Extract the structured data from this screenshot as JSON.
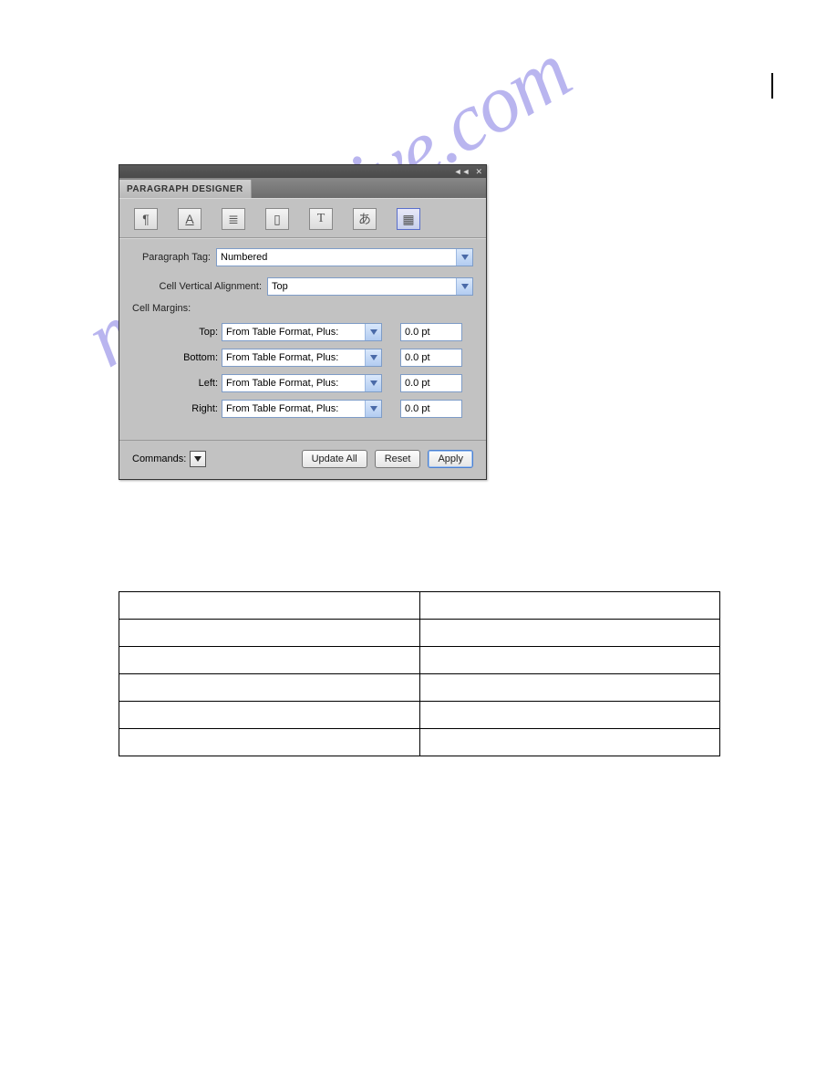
{
  "watermark": "manualshive.com",
  "titlebar": {
    "collapse": "◄◄",
    "close": "✕"
  },
  "tab": {
    "label": "PARAGRAPH DESIGNER"
  },
  "icons": {
    "pilcrow": "¶",
    "font": "A",
    "pagination": "≣",
    "numbering": "▯",
    "advanced": "T",
    "asian": "あ",
    "tablecell": "▦"
  },
  "form": {
    "paragraph_tag_label": "Paragraph Tag:",
    "paragraph_tag_value": "Numbered",
    "cell_valign_label": "Cell Vertical Alignment:",
    "cell_valign_value": "Top",
    "cell_margins_label": "Cell Margins:",
    "margins": {
      "top": {
        "label": "Top:",
        "mode": "From Table Format, Plus:",
        "value": "0.0 pt"
      },
      "bottom": {
        "label": "Bottom:",
        "mode": "From Table Format, Plus:",
        "value": "0.0 pt"
      },
      "left": {
        "label": "Left:",
        "mode": "From Table Format, Plus:",
        "value": "0.0 pt"
      },
      "right": {
        "label": "Right:",
        "mode": "From Table Format, Plus:",
        "value": "0.0 pt"
      }
    }
  },
  "footer": {
    "commands_label": "Commands:",
    "update_all": "Update All",
    "reset": "Reset",
    "apply": "Apply"
  },
  "doc_table": {
    "rows": 6,
    "cols": 2
  }
}
